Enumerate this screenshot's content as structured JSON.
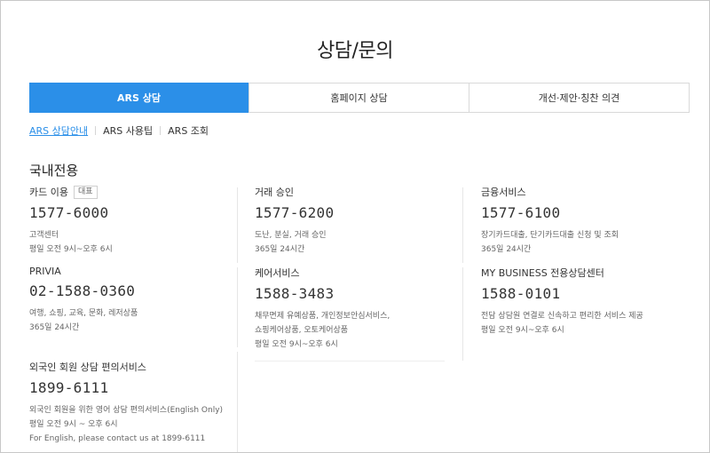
{
  "page": {
    "title": "상담/문의"
  },
  "tabs": [
    {
      "label": "ARS 상담"
    },
    {
      "label": "홈페이지 상담"
    },
    {
      "label": "개선·제안·칭찬 의견"
    }
  ],
  "subnav": [
    {
      "label": "ARS 상담안내"
    },
    {
      "label": "ARS 사용팁"
    },
    {
      "label": "ARS 조회"
    }
  ],
  "section": {
    "title": "국내전용"
  },
  "cards": [
    {
      "name": "카드 이용",
      "tag": "대표",
      "phone": "1577-6000",
      "desc": [
        "고객센터",
        "평일 오전 9시~오후 6시"
      ]
    },
    {
      "name": "거래 승인",
      "phone": "1577-6200",
      "desc": [
        "도난, 분실, 거래 승인",
        "365일 24시간"
      ]
    },
    {
      "name": "금융서비스",
      "phone": "1577-6100",
      "desc": [
        "장기카드대출, 단기카드대출 신청 및 조회",
        "365일 24시간"
      ]
    },
    {
      "name": "PRIVIA",
      "phone": "02-1588-0360",
      "desc": [
        "여행, 쇼핑, 교육, 문화, 레저상품",
        "365일 24시간"
      ]
    },
    {
      "name": "케어서비스",
      "phone": "1588-3483",
      "desc": [
        "채무면제 유예상품, 개인정보안심서비스,",
        "쇼핑케어상품, 오토케어상품",
        "평일 오전 9시~오후 6시"
      ]
    },
    {
      "name": "MY BUSINESS 전용상담센터",
      "phone": "1588-0101",
      "desc": [
        "전담 상담원 연결로 신속하고 편리한 서비스 제공",
        "평일 오전 9시~오후 6시"
      ]
    },
    {
      "name": "외국인 회원 상담 편의서비스",
      "phone": "1899-6111",
      "desc": [
        "외국인 회원을 위한 영어 상담 편의서비스(English Only)",
        "평일 오전 9시 ~ 오후 6시",
        "For English, please contact us at 1899-6111"
      ]
    }
  ]
}
